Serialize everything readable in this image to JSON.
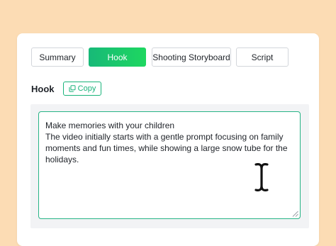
{
  "tabs": [
    {
      "label": "Summary",
      "active": false
    },
    {
      "label": "Hook",
      "active": true
    },
    {
      "label": "Shooting Storyboard",
      "active": false
    },
    {
      "label": "Script",
      "active": false
    }
  ],
  "section": {
    "title": "Hook",
    "copy_label": "Copy"
  },
  "editor": {
    "text": "Make memories with your children\nThe video initially starts with a gentle prompt focusing on family moments and fun times, while showing a large snow tube for the holidays."
  },
  "icons": {
    "copy": "copy-icon",
    "resize": "resize-handle-icon",
    "cursor": "text-cursor-icon"
  },
  "colors": {
    "background": "#fcdcb4",
    "accent": "#19b37a",
    "active_tab_start": "#17b978",
    "active_tab_end": "#1ed760"
  }
}
